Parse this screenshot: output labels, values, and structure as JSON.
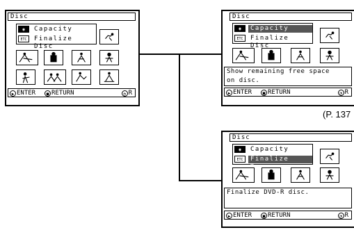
{
  "screen_title": "Disc",
  "menu": {
    "item1_icon": "disc-icon",
    "item1_label": "Capacity",
    "item2_icon_text": "ETC",
    "item2_label": "Finalize Disc"
  },
  "messages": {
    "capacity": [
      "Show remaining free space",
      "on disc."
    ],
    "finalize": [
      "Finalize DVD-R disc."
    ]
  },
  "bottombar": {
    "enter_label": "ENTER",
    "return_label": "RETURN",
    "r_label": "R"
  },
  "page_reference": "(P. 137"
}
